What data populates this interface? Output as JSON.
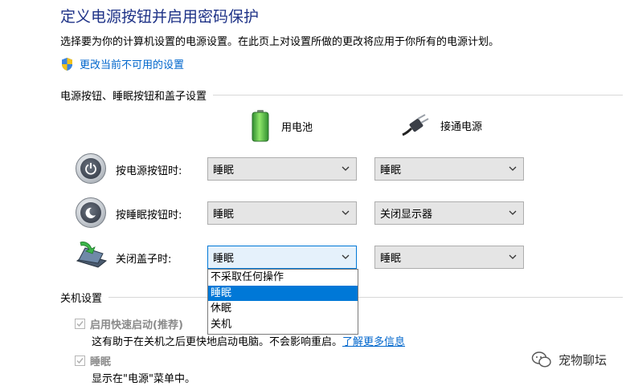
{
  "title": "定义电源按钮并启用密码保护",
  "description": "选择要为你的计算机设置的电源设置。在此页上对设置所做的更改将应用于你所有的电源计划。",
  "change_unavailable_link": "更改当前不可用的设置",
  "section_buttons": "电源按钮、睡眠按钮和盖子设置",
  "col_battery": "用电池",
  "col_plugged": "接通电源",
  "rows": [
    {
      "label": "按电源按钮时:",
      "battery": "睡眠",
      "plugged": "睡眠"
    },
    {
      "label": "按睡眠按钮时:",
      "battery": "睡眠",
      "plugged": "关闭显示器"
    },
    {
      "label": "关闭盖子时:",
      "battery": "睡眠",
      "plugged": "睡眠"
    }
  ],
  "dropdown_options": [
    "不采取任何操作",
    "睡眠",
    "休眠",
    "关机"
  ],
  "dropdown_selected": "睡眠",
  "section_shutdown": "关机设置",
  "fast_startup_label": "启用快速启动(推荐)",
  "fast_startup_help": "这有助于在关机之后更快地启动电脑。不会影响重启。",
  "learn_more": "了解更多信息",
  "sleep_label": "睡眠",
  "sleep_help": "显示在\"电源\"菜单中。",
  "watermark": "宠物聊坛",
  "colors": {
    "title": "#1e3287",
    "link": "#0066cc",
    "selected": "#0078d7"
  }
}
